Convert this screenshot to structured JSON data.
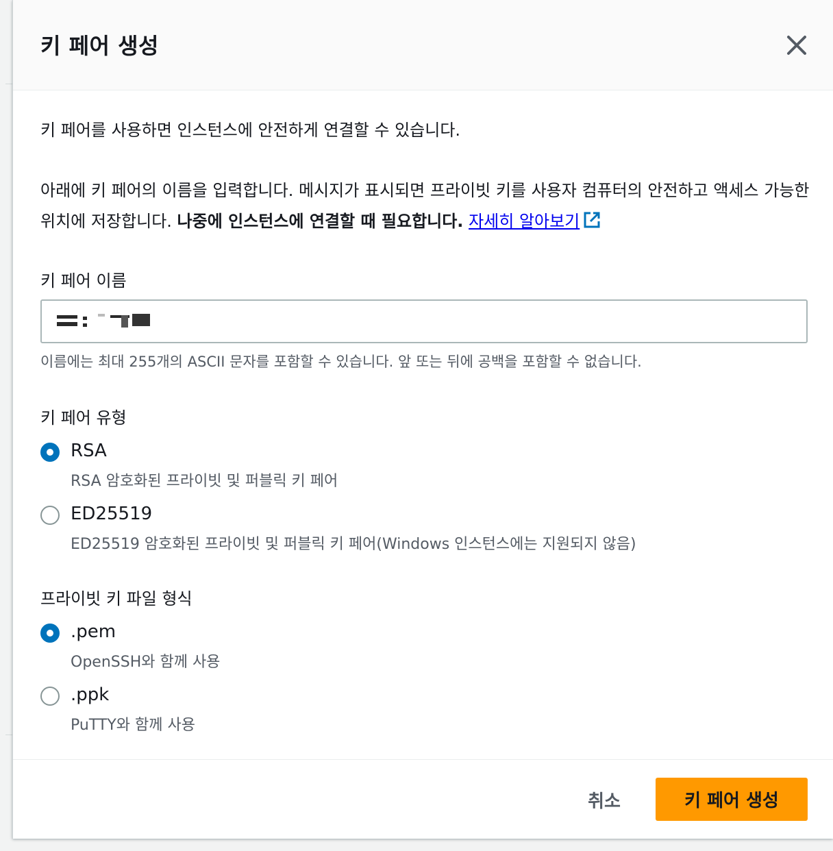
{
  "dialog": {
    "title": "키 페어 생성",
    "close_label": "×"
  },
  "intro": {
    "line1": "키 페어를 사용하면 인스턴스에 안전하게 연결할 수 있습니다.",
    "line2_text": "아래에 키 페어의 이름을 입력합니다. 메시지가 표시되면 프라이빗 키를 사용자 컴퓨터의 안전하고 액세스 가능한 위치에 저장합니다. ",
    "line2_bold": "나중에 인스턴스에 연결할 때 필요합니다.",
    "learn_more": "자세히 알아보기"
  },
  "name_field": {
    "label": "키 페어 이름",
    "value": "",
    "hint": "이름에는 최대 255개의 ASCII 문자를 포함할 수 있습니다. 앞 또는 뒤에 공백을 포함할 수 없습니다."
  },
  "key_type": {
    "label": "키 페어 유형",
    "options": [
      {
        "label": "RSA",
        "desc": "RSA 암호화된 프라이빗 및 퍼블릭 키 페어",
        "checked": true
      },
      {
        "label": "ED25519",
        "desc": "ED25519 암호화된 프라이빗 및 퍼블릭 키 페어(Windows 인스턴스에는 지원되지 않음)",
        "checked": false
      }
    ]
  },
  "file_format": {
    "label": "프라이빗 키 파일 형식",
    "options": [
      {
        "label": ".pem",
        "desc": "OpenSSH와 함께 사용",
        "checked": true
      },
      {
        "label": ".ppk",
        "desc": "PuTTY와 함께 사용",
        "checked": false
      }
    ]
  },
  "footer": {
    "cancel_label": "취소",
    "create_label": "키 페어 생성"
  },
  "colors": {
    "accent": "#0073bb",
    "primary_button": "#ff9900",
    "link": "#0000ee"
  }
}
